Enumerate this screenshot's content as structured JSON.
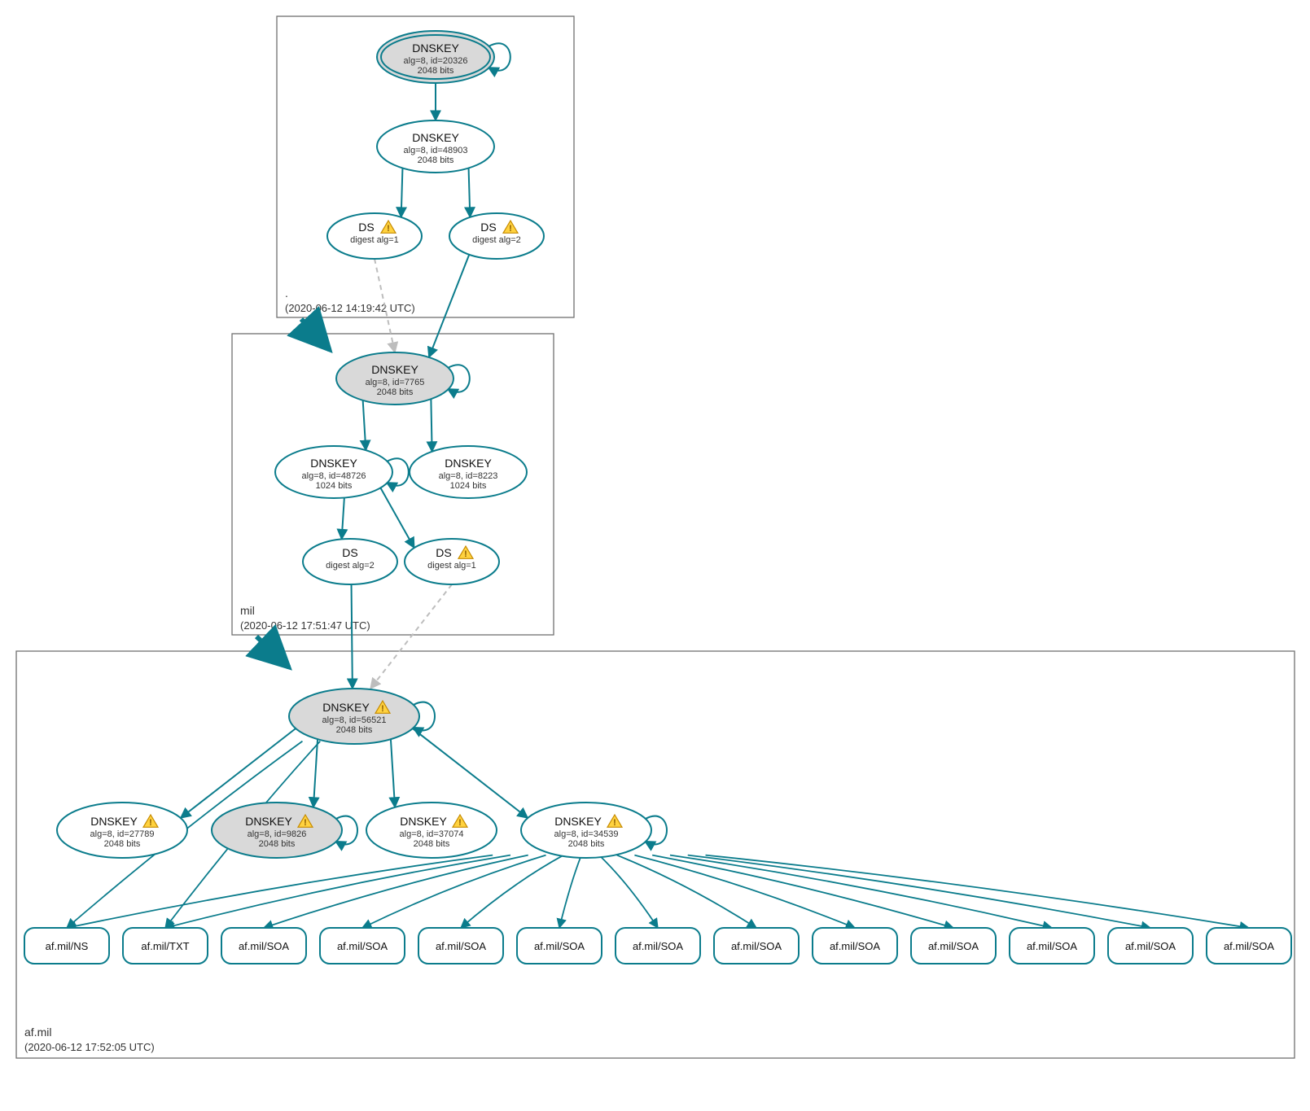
{
  "colors": {
    "stroke": "#0b7c8c",
    "fillGray": "#d9d9d9",
    "fillWhite": "#ffffff",
    "boxStroke": "#707070",
    "dashed": "#bdbdbd"
  },
  "zones": [
    {
      "id": "zroot",
      "name": ".",
      "ts": "(2020-06-12 14:19:42 UTC)"
    },
    {
      "id": "zmil",
      "name": "mil",
      "ts": "(2020-06-12 17:51:47 UTC)"
    },
    {
      "id": "zaf",
      "name": "af.mil",
      "ts": "(2020-06-12 17:52:05 UTC)"
    }
  ],
  "nodes": {
    "root_ksk": {
      "title": "DNSKEY",
      "sub1": "alg=8, id=20326",
      "sub2": "2048 bits",
      "warn": false,
      "gray": true,
      "double": true
    },
    "root_zsk": {
      "title": "DNSKEY",
      "sub1": "alg=8, id=48903",
      "sub2": "2048 bits",
      "warn": false,
      "gray": false,
      "double": false
    },
    "root_ds1": {
      "title": "DS",
      "sub1": "digest alg=1",
      "sub2": "",
      "warn": true,
      "gray": false,
      "double": false
    },
    "root_ds2": {
      "title": "DS",
      "sub1": "digest alg=2",
      "sub2": "",
      "warn": true,
      "gray": false,
      "double": false
    },
    "mil_ksk": {
      "title": "DNSKEY",
      "sub1": "alg=8, id=7765",
      "sub2": "2048 bits",
      "warn": false,
      "gray": true,
      "double": false
    },
    "mil_k1": {
      "title": "DNSKEY",
      "sub1": "alg=8, id=48726",
      "sub2": "1024 bits",
      "warn": false,
      "gray": false,
      "double": false
    },
    "mil_k2": {
      "title": "DNSKEY",
      "sub1": "alg=8, id=8223",
      "sub2": "1024 bits",
      "warn": false,
      "gray": false,
      "double": false
    },
    "mil_ds2": {
      "title": "DS",
      "sub1": "digest alg=2",
      "sub2": "",
      "warn": false,
      "gray": false,
      "double": false
    },
    "mil_ds1": {
      "title": "DS",
      "sub1": "digest alg=1",
      "sub2": "",
      "warn": true,
      "gray": false,
      "double": false
    },
    "af_ksk": {
      "title": "DNSKEY",
      "sub1": "alg=8, id=56521",
      "sub2": "2048 bits",
      "warn": true,
      "gray": true,
      "double": false
    },
    "af_k1": {
      "title": "DNSKEY",
      "sub1": "alg=8, id=27789",
      "sub2": "2048 bits",
      "warn": true,
      "gray": false,
      "double": false
    },
    "af_k2": {
      "title": "DNSKEY",
      "sub1": "alg=8, id=9826",
      "sub2": "2048 bits",
      "warn": true,
      "gray": true,
      "double": false
    },
    "af_k3": {
      "title": "DNSKEY",
      "sub1": "alg=8, id=37074",
      "sub2": "2048 bits",
      "warn": true,
      "gray": false,
      "double": false
    },
    "af_k4": {
      "title": "DNSKEY",
      "sub1": "alg=8, id=34539",
      "sub2": "2048 bits",
      "warn": true,
      "gray": false,
      "double": false
    }
  },
  "records": [
    "af.mil/NS",
    "af.mil/TXT",
    "af.mil/SOA",
    "af.mil/SOA",
    "af.mil/SOA",
    "af.mil/SOA",
    "af.mil/SOA",
    "af.mil/SOA",
    "af.mil/SOA",
    "af.mil/SOA",
    "af.mil/SOA",
    "af.mil/SOA",
    "af.mil/SOA"
  ]
}
